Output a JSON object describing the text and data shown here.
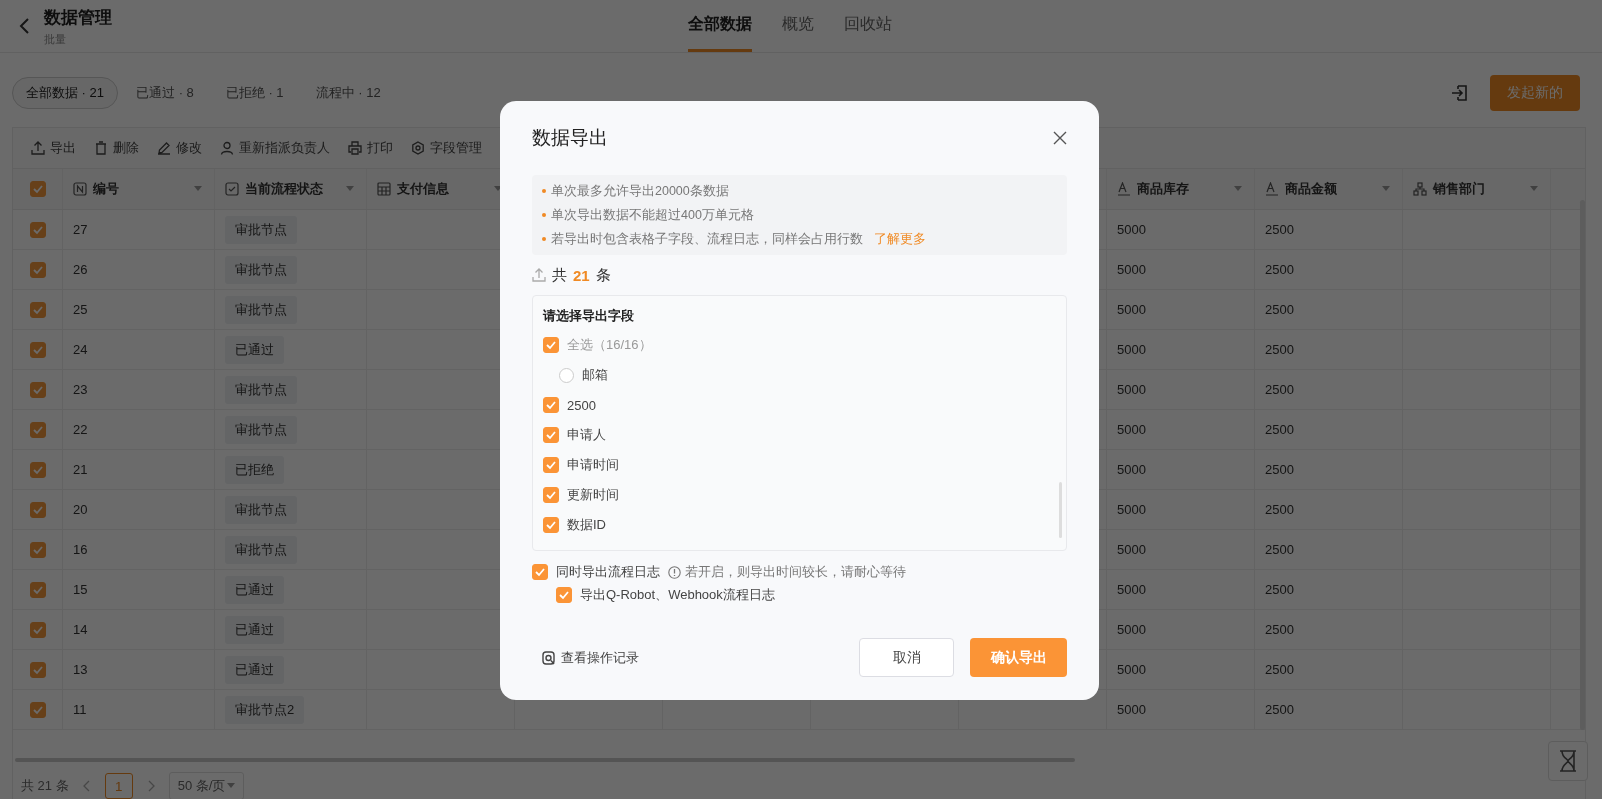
{
  "header": {
    "title": "数据管理",
    "subtitle": "批量"
  },
  "nav_tabs": [
    {
      "label": "全部数据",
      "selected": true
    },
    {
      "label": "概览",
      "selected": false
    },
    {
      "label": "回收站",
      "selected": false
    }
  ],
  "filters": [
    {
      "label": "全部数据 · 21",
      "selected": true
    },
    {
      "label": "已通过 · 8",
      "selected": false
    },
    {
      "label": "已拒绝 · 1",
      "selected": false
    },
    {
      "label": "流程中 · 12",
      "selected": false
    }
  ],
  "new_button": "发起新的",
  "toolbar": [
    {
      "label": "导出"
    },
    {
      "label": "删除"
    },
    {
      "label": "修改"
    },
    {
      "label": "重新指派负责人"
    },
    {
      "label": "打印"
    },
    {
      "label": "字段管理"
    }
  ],
  "table": {
    "all_checked": true,
    "columns": [
      {
        "label": "编号"
      },
      {
        "label": "当前流程状态"
      },
      {
        "label": "支付信息"
      },
      {
        "label": "商品库存"
      },
      {
        "label": "商品金额"
      },
      {
        "label": "销售部门"
      }
    ],
    "rows": [
      {
        "checked": true,
        "id": "27",
        "status": "审批节点",
        "stock": "5000",
        "amount": "2500"
      },
      {
        "checked": true,
        "id": "26",
        "status": "审批节点",
        "stock": "5000",
        "amount": "2500"
      },
      {
        "checked": true,
        "id": "25",
        "status": "审批节点",
        "stock": "5000",
        "amount": "2500"
      },
      {
        "checked": true,
        "id": "24",
        "status": "已通过",
        "stock": "5000",
        "amount": "2500"
      },
      {
        "checked": true,
        "id": "23",
        "status": "审批节点",
        "stock": "5000",
        "amount": "2500"
      },
      {
        "checked": true,
        "id": "22",
        "status": "审批节点",
        "stock": "5000",
        "amount": "2500"
      },
      {
        "checked": true,
        "id": "21",
        "status": "已拒绝",
        "stock": "5000",
        "amount": "2500"
      },
      {
        "checked": true,
        "id": "20",
        "status": "审批节点",
        "stock": "5000",
        "amount": "2500"
      },
      {
        "checked": true,
        "id": "16",
        "status": "审批节点",
        "stock": "5000",
        "amount": "2500"
      },
      {
        "checked": true,
        "id": "15",
        "status": "已通过",
        "stock": "5000",
        "amount": "2500"
      },
      {
        "checked": true,
        "id": "14",
        "status": "已通过",
        "stock": "5000",
        "amount": "2500"
      },
      {
        "checked": true,
        "id": "13",
        "status": "已通过",
        "stock": "5000",
        "amount": "2500"
      },
      {
        "checked": true,
        "id": "11",
        "status": "审批节点2",
        "stock": "5000",
        "amount": "2500"
      }
    ]
  },
  "pagination": {
    "total": "共 21 条",
    "page": "1",
    "page_size": "50 条/页"
  },
  "dialog": {
    "title": "数据导出",
    "notes": [
      {
        "text": "单次最多允许导出20000条数据"
      },
      {
        "text": "单次导出数据不能超过400万单元格"
      },
      {
        "text": "若导出时包含表格子字段、流程日志，同样会占用行数",
        "link": "了解更多"
      }
    ],
    "count_prefix": "共",
    "count": "21",
    "count_suffix": "条",
    "fields_title": "请选择导出字段",
    "fields": [
      {
        "kind": "select_all",
        "label": "全选（16/16）",
        "checked": true
      },
      {
        "kind": "radio",
        "label": "邮箱",
        "checked": false
      },
      {
        "kind": "checkbox",
        "label": "2500",
        "checked": true
      },
      {
        "kind": "checkbox",
        "label": "申请人",
        "checked": true
      },
      {
        "kind": "checkbox",
        "label": "申请时间",
        "checked": true
      },
      {
        "kind": "checkbox",
        "label": "更新时间",
        "checked": true
      },
      {
        "kind": "checkbox",
        "label": "数据ID",
        "checked": true
      }
    ],
    "log_option": {
      "label": "同时导出流程日志",
      "checked": true,
      "hint": "若开启，则导出时间较长，请耐心等待"
    },
    "sub_option": {
      "label": "导出Q-Robot、Webhook流程日志",
      "checked": true
    },
    "history_link": "查看操作记录",
    "cancel": "取消",
    "confirm": "确认导出"
  }
}
